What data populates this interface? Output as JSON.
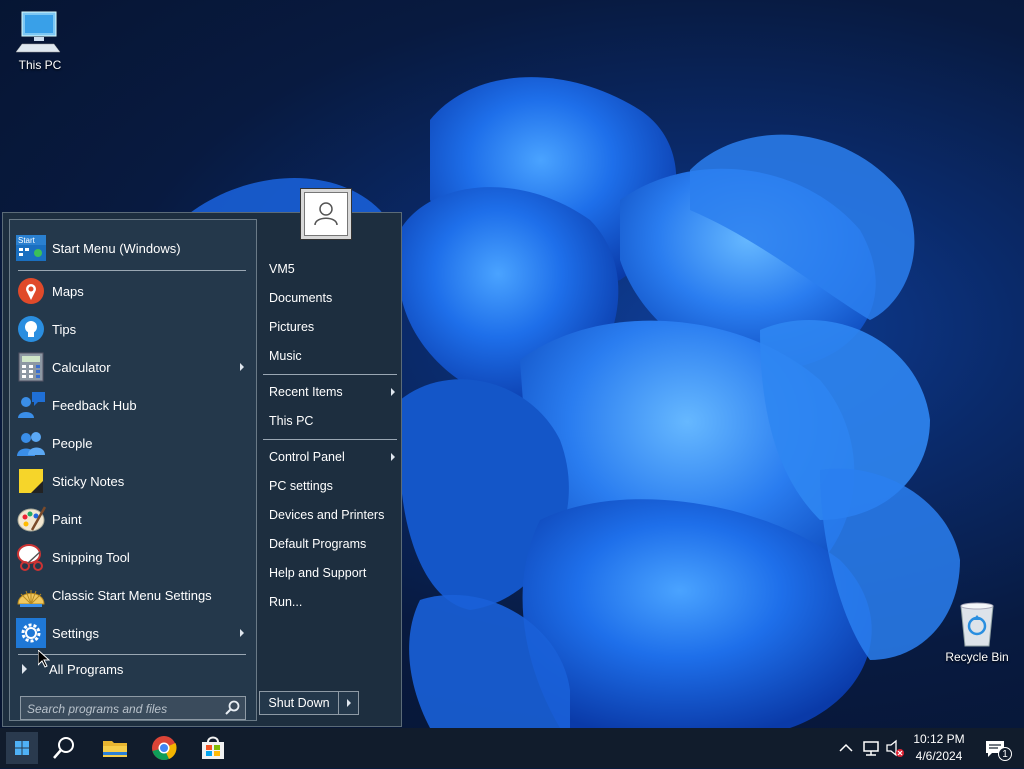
{
  "desktop": {
    "icons": [
      {
        "label": "This PC"
      },
      {
        "label": "Recycle Bin"
      }
    ]
  },
  "start_menu": {
    "header": {
      "label": "Start Menu (Windows)",
      "icon_text": "Start"
    },
    "programs": [
      {
        "label": "Maps",
        "icon": "maps-pin-icon",
        "has_submenu": false
      },
      {
        "label": "Tips",
        "icon": "lightbulb-icon",
        "has_submenu": false
      },
      {
        "label": "Calculator",
        "icon": "calculator-icon",
        "has_submenu": true
      },
      {
        "label": "Feedback Hub",
        "icon": "feedback-icon",
        "has_submenu": false
      },
      {
        "label": "People",
        "icon": "people-icon",
        "has_submenu": false
      },
      {
        "label": "Sticky Notes",
        "icon": "sticky-notes-icon",
        "has_submenu": false
      },
      {
        "label": "Paint",
        "icon": "paint-palette-icon",
        "has_submenu": false
      },
      {
        "label": "Snipping Tool",
        "icon": "scissors-icon",
        "has_submenu": false
      },
      {
        "label": "Classic Start Menu Settings",
        "icon": "shell-icon",
        "has_submenu": false
      },
      {
        "label": "Settings",
        "icon": "gear-icon",
        "has_submenu": true
      }
    ],
    "all_programs": "All Programs",
    "search_placeholder": "Search programs and files",
    "right_group_1": [
      "VM5",
      "Documents",
      "Pictures",
      "Music"
    ],
    "right_group_2": [
      {
        "label": "Recent Items",
        "has_submenu": true
      },
      {
        "label": "This PC",
        "has_submenu": false
      }
    ],
    "right_group_3": [
      {
        "label": "Control Panel",
        "has_submenu": true
      },
      {
        "label": "PC settings",
        "has_submenu": false
      },
      {
        "label": "Devices and Printers",
        "has_submenu": false
      },
      {
        "label": "Default Programs",
        "has_submenu": false
      },
      {
        "label": "Help and Support",
        "has_submenu": false
      },
      {
        "label": "Run...",
        "has_submenu": false
      }
    ],
    "shutdown_label": "Shut Down"
  },
  "taskbar": {
    "time": "10:12 PM",
    "date": "4/6/2024",
    "notification_count": "1"
  },
  "colors": {
    "accent": "#0078d4",
    "menu_bg": "#24384b",
    "taskbar_bg": "#111c2c"
  }
}
